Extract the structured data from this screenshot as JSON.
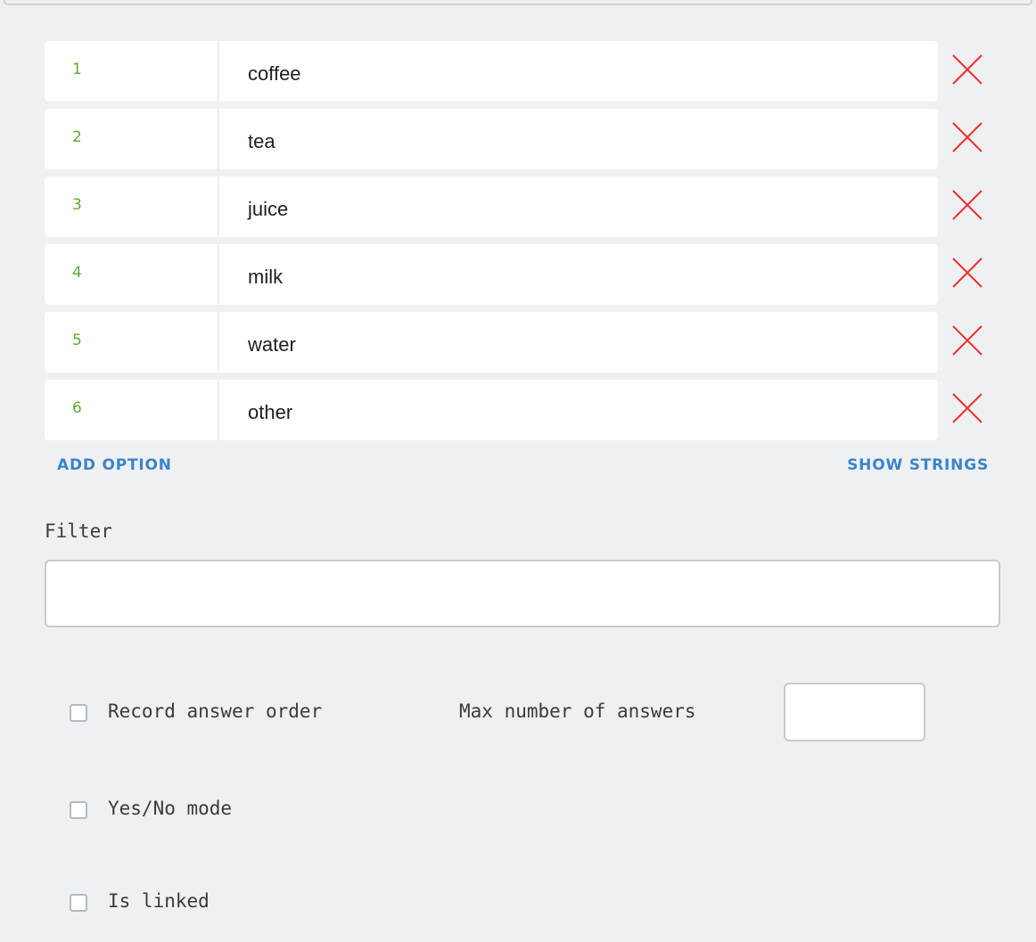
{
  "options": [
    {
      "value": "1",
      "title": "coffee"
    },
    {
      "value": "2",
      "title": "tea"
    },
    {
      "value": "3",
      "title": "juice"
    },
    {
      "value": "4",
      "title": "milk"
    },
    {
      "value": "5",
      "title": "water"
    },
    {
      "value": "6",
      "title": "other"
    }
  ],
  "actions": {
    "add_option": "ADD OPTION",
    "show_strings": "SHOW STRINGS"
  },
  "filter": {
    "label": "Filter",
    "value": ""
  },
  "settings": {
    "record_answer_order": {
      "label": "Record answer order",
      "checked": false
    },
    "max_answers": {
      "label": "Max number of answers",
      "value": ""
    },
    "yes_no_mode": {
      "label": "Yes/No mode",
      "checked": false
    },
    "is_linked": {
      "label": "Is linked",
      "checked": false
    }
  },
  "icons": {
    "delete": "close-icon"
  },
  "colors": {
    "background": "#eff0f2",
    "option_value": "#5fa833",
    "link": "#3a84c9",
    "delete": "#ee3030"
  }
}
